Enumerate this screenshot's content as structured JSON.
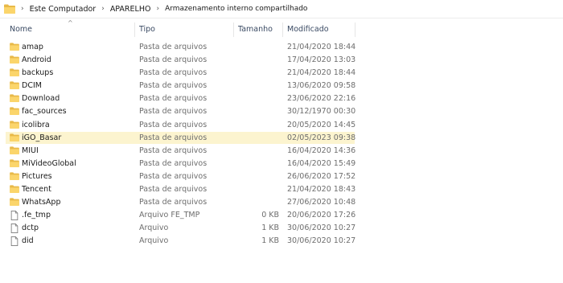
{
  "breadcrumb": {
    "segments": [
      "Este Computador",
      "APARELHO",
      "Armazenamento interno compartilhado"
    ]
  },
  "columns": {
    "name": "Nome",
    "type": "Tipo",
    "size": "Tamanho",
    "modified": "Modificado"
  },
  "files": [
    {
      "name": "amap",
      "type": "Pasta de arquivos",
      "size": "",
      "modified": "21/04/2020 18:44",
      "icon": "folder-icon"
    },
    {
      "name": "Android",
      "type": "Pasta de arquivos",
      "size": "",
      "modified": "17/04/2020 13:03",
      "icon": "folder-icon"
    },
    {
      "name": "backups",
      "type": "Pasta de arquivos",
      "size": "",
      "modified": "21/04/2020 18:44",
      "icon": "folder-icon"
    },
    {
      "name": "DCIM",
      "type": "Pasta de arquivos",
      "size": "",
      "modified": "13/06/2020 09:58",
      "icon": "folder-icon"
    },
    {
      "name": "Download",
      "type": "Pasta de arquivos",
      "size": "",
      "modified": "23/06/2020 22:16",
      "icon": "folder-icon"
    },
    {
      "name": "fac_sources",
      "type": "Pasta de arquivos",
      "size": "",
      "modified": "30/12/1970 00:30",
      "icon": "folder-icon"
    },
    {
      "name": "icolibra",
      "type": "Pasta de arquivos",
      "size": "",
      "modified": "20/05/2020 14:45",
      "icon": "folder-icon"
    },
    {
      "name": "iGO_Basar",
      "type": "Pasta de arquivos",
      "size": "",
      "modified": "02/05/2023 09:38",
      "icon": "folder-icon",
      "selected": true
    },
    {
      "name": "MIUI",
      "type": "Pasta de arquivos",
      "size": "",
      "modified": "16/04/2020 14:36",
      "icon": "folder-icon"
    },
    {
      "name": "MiVideoGlobal",
      "type": "Pasta de arquivos",
      "size": "",
      "modified": "16/04/2020 15:49",
      "icon": "folder-icon"
    },
    {
      "name": "Pictures",
      "type": "Pasta de arquivos",
      "size": "",
      "modified": "26/06/2020 17:52",
      "icon": "folder-icon"
    },
    {
      "name": "Tencent",
      "type": "Pasta de arquivos",
      "size": "",
      "modified": "21/04/2020 18:43",
      "icon": "folder-icon"
    },
    {
      "name": "WhatsApp",
      "type": "Pasta de arquivos",
      "size": "",
      "modified": "27/06/2020 10:48",
      "icon": "folder-icon"
    },
    {
      "name": ".fe_tmp",
      "type": "Arquivo FE_TMP",
      "size": "0 KB",
      "modified": "20/06/2020 17:26",
      "icon": "file-icon"
    },
    {
      "name": "dctp",
      "type": "Arquivo",
      "size": "1 KB",
      "modified": "30/06/2020 10:27",
      "icon": "file-icon"
    },
    {
      "name": "did",
      "type": "Arquivo",
      "size": "1 KB",
      "modified": "30/06/2020 10:27",
      "icon": "file-icon"
    }
  ],
  "colors": {
    "folder": "#fbd56b",
    "selection": "#fcf4cf",
    "header_text": "#3a4a63"
  }
}
